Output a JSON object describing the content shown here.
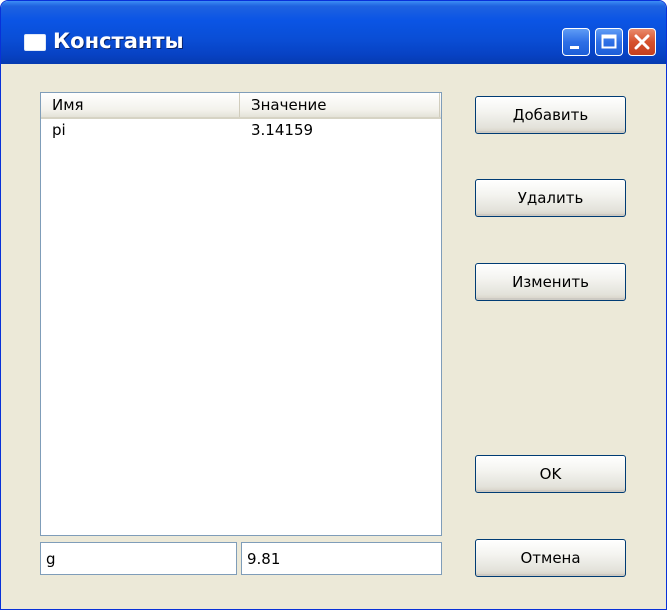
{
  "window": {
    "title": "Константы",
    "icons": {
      "app": "window-icon",
      "minimize": "minimize-icon",
      "maximize": "maximize-icon",
      "close": "close-icon"
    },
    "colors": {
      "titlebar": "#0a4ed6",
      "close_button": "#d6512d",
      "client_background": "#ece9d8"
    }
  },
  "list": {
    "columns": [
      "Имя",
      "Значение"
    ],
    "rows": [
      {
        "name": "pi",
        "value": "3.14159"
      }
    ]
  },
  "inputs": {
    "name_value": "g",
    "value_value": "9.81"
  },
  "buttons": {
    "add": "Добавить",
    "delete": "Удалить",
    "edit": "Изменить",
    "ok": "OK",
    "cancel": "Отмена"
  }
}
